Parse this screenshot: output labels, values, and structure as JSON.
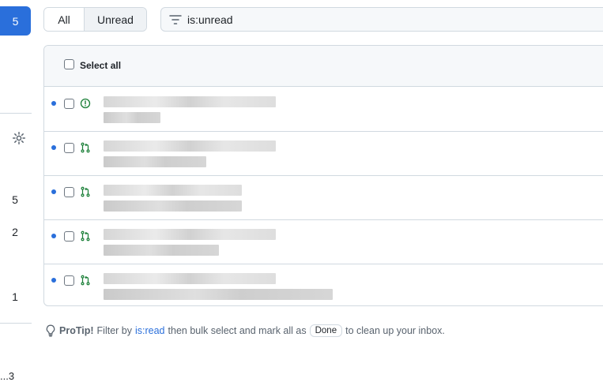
{
  "sidebar": {
    "active_count": "5",
    "counts": [
      "5",
      "2",
      "1"
    ],
    "truncated_label": "...3"
  },
  "filters": {
    "all_label": "All",
    "unread_label": "Unread",
    "search_value": "is:unread"
  },
  "list": {
    "select_all_label": "Select all",
    "rows": [
      {
        "type": "issue-icon",
        "unread": true
      },
      {
        "type": "pull-request-icon",
        "unread": true
      },
      {
        "type": "pull-request-icon",
        "unread": true
      },
      {
        "type": "pull-request-icon",
        "unread": true
      },
      {
        "type": "pull-request-icon",
        "unread": true
      }
    ]
  },
  "protip": {
    "title": "ProTip!",
    "text_before": "Filter by",
    "link": "is:read",
    "text_middle": "then bulk select and mark all as",
    "badge": "Done",
    "text_after": "to clean up your inbox."
  },
  "colors": {
    "accent": "#2a6fdb",
    "issue_icon": "#1a7f37",
    "pr_icon": "#1a7f37"
  }
}
